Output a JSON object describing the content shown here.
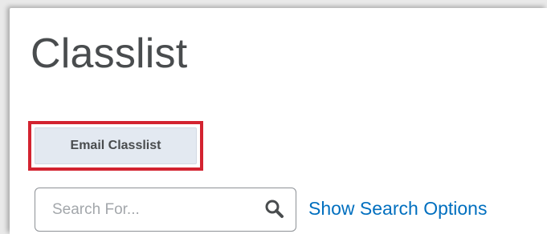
{
  "page": {
    "title": "Classlist"
  },
  "actions": {
    "email_classlist_label": "Email Classlist"
  },
  "search": {
    "placeholder": "Search For...",
    "value": "",
    "button_icon": "magnifier-icon",
    "options_link_label": "Show Search Options"
  },
  "colors": {
    "highlight_border": "#d32330",
    "button_background": "#e3e9f1",
    "link": "#006fbf",
    "title_text": "#494c4e"
  }
}
